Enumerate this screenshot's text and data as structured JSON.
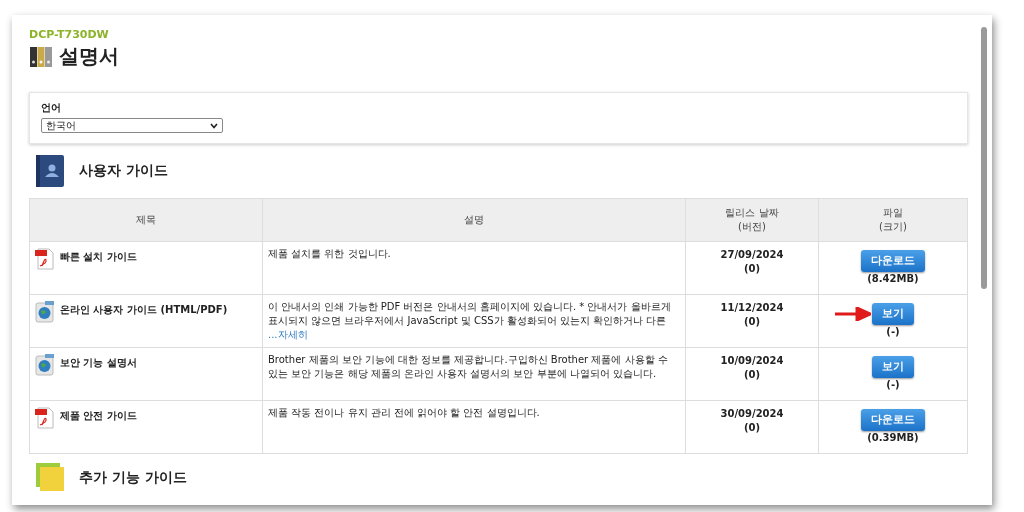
{
  "model": "DCP-T730DW",
  "title": "설명서",
  "language": {
    "label": "언어",
    "value": "한국어"
  },
  "sections": [
    {
      "title": "사용자 가이드",
      "kind": "user"
    }
  ],
  "table": {
    "columns": [
      {
        "label": "제목"
      },
      {
        "label": "설명"
      },
      {
        "label": "릴리스 날짜",
        "sub": "(버전)"
      },
      {
        "label": "파일",
        "sub": "(크기)"
      }
    ],
    "rows": [
      {
        "title": "빠른 설치 가이드",
        "kind": "pdf",
        "description": "제품 설치를 위한 것입니다.",
        "date": "27/09/2024",
        "version": "(0)",
        "button": "다운로드",
        "size": "(8.42MB)",
        "highlighted": false
      },
      {
        "title": "온라인 사용자 가이드 (HTML/PDF)",
        "kind": "web",
        "description": "이 안내서의 인쇄 가능한 PDF 버전은 안내서의 홈페이지에 있습니다. * 안내서가 올바르게 표시되지 않으면 브라우저에서 JavaScript 및 CSS가 활성화되어 있는지 확인하거나 다른",
        "more": "...자세히",
        "date": "11/12/2024",
        "version": "(0)",
        "button": "보기",
        "size": "(-)",
        "highlighted": true
      },
      {
        "title": "보안 기능 설명서",
        "kind": "web",
        "description": "Brother 제품의 보안 기능에 대한 정보를 제공합니다.구입하신 Brother 제품에 사용할 수 있는 보안 기능은 해당 제품의 온라인 사용자 설명서의 보안 부분에 나열되어 있습니다.",
        "date": "10/09/2024",
        "version": "(0)",
        "button": "보기",
        "size": "(-)",
        "highlighted": false
      },
      {
        "title": "제품 안전 가이드",
        "kind": "pdf",
        "description": "제품 작동 전이나 유지 관리 전에 읽어야 할 안전 설명입니다.",
        "date": "30/09/2024",
        "version": "(0)",
        "button": "다운로드",
        "size": "(0.39MB)",
        "highlighted": false
      }
    ]
  },
  "next_section": {
    "title": "추가 기능 가이드",
    "kind": "tips"
  }
}
